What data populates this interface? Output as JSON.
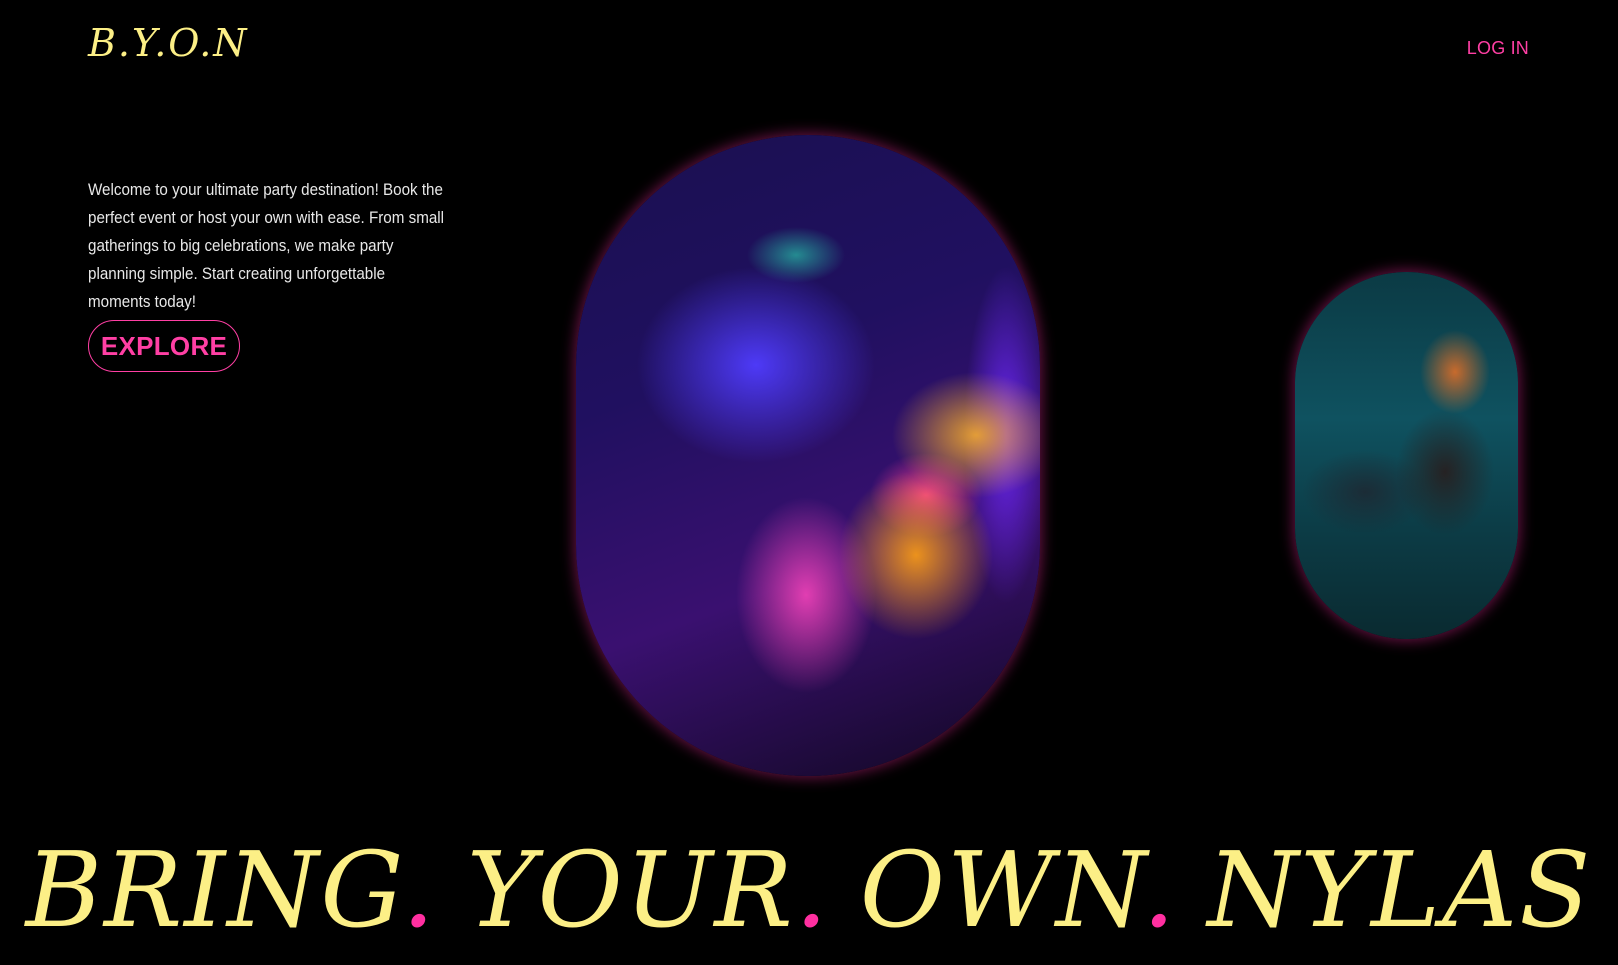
{
  "header": {
    "logo": "B.Y.O.N",
    "login_label": "LOG IN"
  },
  "hero": {
    "intro": "Welcome to your ultimate party destination! Book the perfect event or host your own with ease. From small gatherings to big celebrations, we make party planning simple. Start creating unforgettable moments today!",
    "explore_label": "EXPLORE"
  },
  "images": {
    "main": "neon-face-paint-photo",
    "secondary": "party-bear-mascot-photo"
  },
  "headline": {
    "words": [
      "BRING",
      "YOUR",
      "OWN",
      "NYLAS"
    ],
    "separator": "."
  },
  "colors": {
    "background": "#000000",
    "accent_yellow": "#fcef86",
    "accent_pink": "#ff3fa4"
  }
}
